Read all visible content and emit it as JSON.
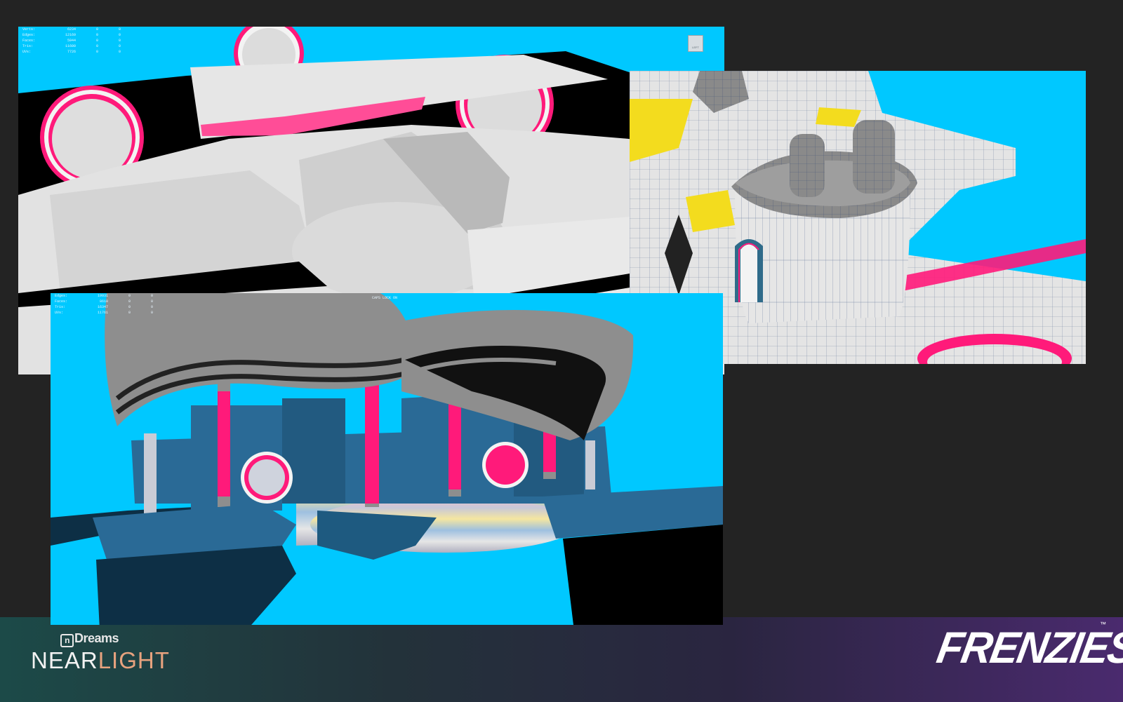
{
  "viewport_top_left": {
    "stats": [
      {
        "label": "Verts:",
        "value": "6234",
        "a": "0",
        "b": "0"
      },
      {
        "label": "Edges:",
        "value": "12169",
        "a": "0",
        "b": "0"
      },
      {
        "label": "Faces:",
        "value": "5944",
        "a": "0",
        "b": "0"
      },
      {
        "label": "Tris:",
        "value": "11600",
        "a": "0",
        "b": "0"
      },
      {
        "label": "UVs:",
        "value": "7726",
        "a": "0",
        "b": "0"
      }
    ],
    "viewcube_label": "LEFT"
  },
  "viewport_bottom": {
    "stats": [
      {
        "label": "Edges:",
        "value": "19931",
        "a": "0",
        "b": "0"
      },
      {
        "label": "Faces:",
        "value": "8610",
        "a": "0",
        "b": "0"
      },
      {
        "label": "Tris:",
        "value": "16347",
        "a": "0",
        "b": "0"
      },
      {
        "label": "UVs:",
        "value": "11761",
        "a": "0",
        "b": "0"
      }
    ],
    "caps_lock": "CAPS LOCK ON"
  },
  "branding": {
    "studio": "Dreams",
    "studio_mark": "n",
    "sub_a": "NEAR",
    "sub_b": "LIGHT",
    "game_title": "FRENZIES",
    "trademark": "™"
  },
  "colors": {
    "background": "#232323",
    "viewport_sky": "#00c8ff",
    "accent_pink": "#ff1a7a",
    "model_grey": "#d9d9d9",
    "model_blue": "#2a6a96"
  }
}
